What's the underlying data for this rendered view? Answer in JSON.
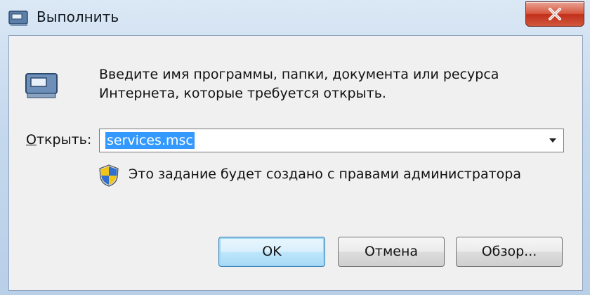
{
  "window": {
    "title": "Выполнить",
    "title_icon": "run-dialog-icon",
    "close_icon": "close-icon"
  },
  "dialog": {
    "description_line1": "Введите имя программы, папки, документа или ресурса",
    "description_line2": "Интернета, которые требуется открыть.",
    "open_label_accel": "О",
    "open_label_rest": "ткрыть:",
    "input_value": "services.msc",
    "admin_note": "Это задание будет создано с правами администратора"
  },
  "buttons": {
    "ok": "OK",
    "cancel": "Отмена",
    "browse": "Обзор..."
  },
  "colors": {
    "selection": "#3399ff",
    "close_button": "#c1301b",
    "default_button_border": "#3c7fb1"
  }
}
